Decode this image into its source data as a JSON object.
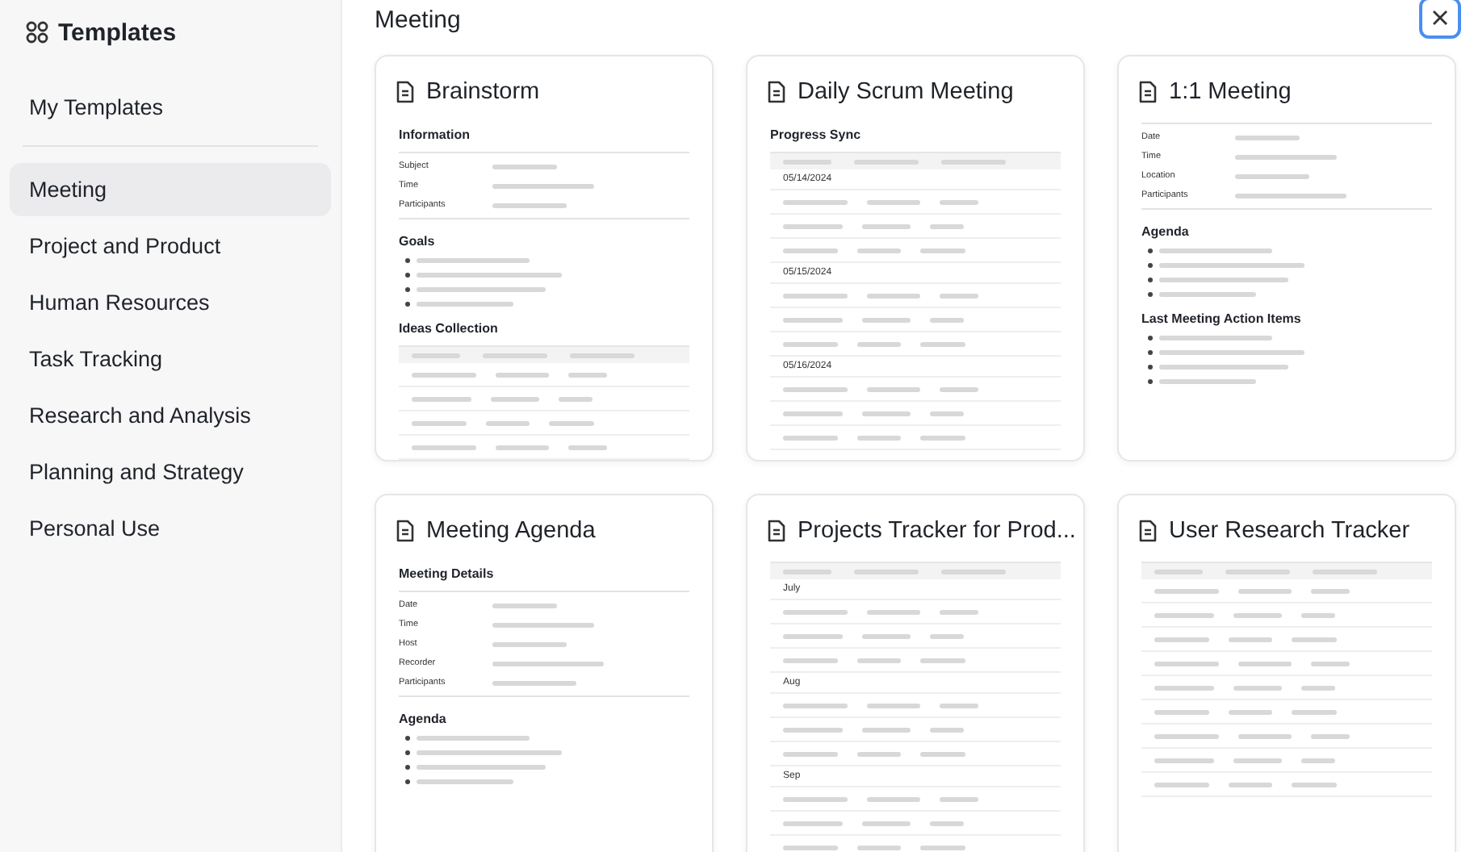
{
  "sidebar": {
    "title": "Templates",
    "my_templates": "My Templates",
    "items": [
      {
        "label": "Meeting",
        "selected": true
      },
      {
        "label": "Project and Product",
        "selected": false
      },
      {
        "label": "Human Resources",
        "selected": false
      },
      {
        "label": "Task Tracking",
        "selected": false
      },
      {
        "label": "Research and Analysis",
        "selected": false
      },
      {
        "label": "Planning and Strategy",
        "selected": false
      },
      {
        "label": "Personal Use",
        "selected": false
      }
    ]
  },
  "main": {
    "title": "Meeting",
    "cards": [
      {
        "title": "Brainstorm",
        "preview": [
          {
            "kind": "heading",
            "text": "Information"
          },
          {
            "kind": "fields",
            "labels": [
              "Subject",
              "Time",
              "Participants"
            ]
          },
          {
            "kind": "heading",
            "text": "Goals"
          },
          {
            "kind": "bullets"
          },
          {
            "kind": "heading",
            "text": "Ideas Collection"
          },
          {
            "kind": "table"
          }
        ]
      },
      {
        "title": "Daily Scrum Meeting",
        "preview": [
          {
            "kind": "heading",
            "text": "Progress Sync"
          },
          {
            "kind": "table",
            "groups": [
              "05/14/2024",
              "05/15/2024",
              "05/16/2024"
            ]
          }
        ]
      },
      {
        "title": "1:1 Meeting",
        "preview": [
          {
            "kind": "fields",
            "labels": [
              "Date",
              "Time",
              "Location",
              "Participants"
            ]
          },
          {
            "kind": "heading",
            "text": "Agenda"
          },
          {
            "kind": "bullets"
          },
          {
            "kind": "heading",
            "text": "Last Meeting Action Items"
          },
          {
            "kind": "bullets"
          }
        ]
      },
      {
        "title": "Meeting Agenda",
        "preview": [
          {
            "kind": "heading",
            "text": "Meeting Details"
          },
          {
            "kind": "fields",
            "labels": [
              "Date",
              "Time",
              "Host",
              "Recorder",
              "Participants"
            ]
          },
          {
            "kind": "heading",
            "text": "Agenda"
          },
          {
            "kind": "bullets"
          }
        ]
      },
      {
        "title": "Projects Tracker for Prod...",
        "preview": [
          {
            "kind": "table",
            "groups": [
              "July",
              "Aug",
              "Sep"
            ]
          }
        ]
      },
      {
        "title": "User Research Tracker",
        "preview": [
          {
            "kind": "table"
          }
        ]
      }
    ]
  }
}
